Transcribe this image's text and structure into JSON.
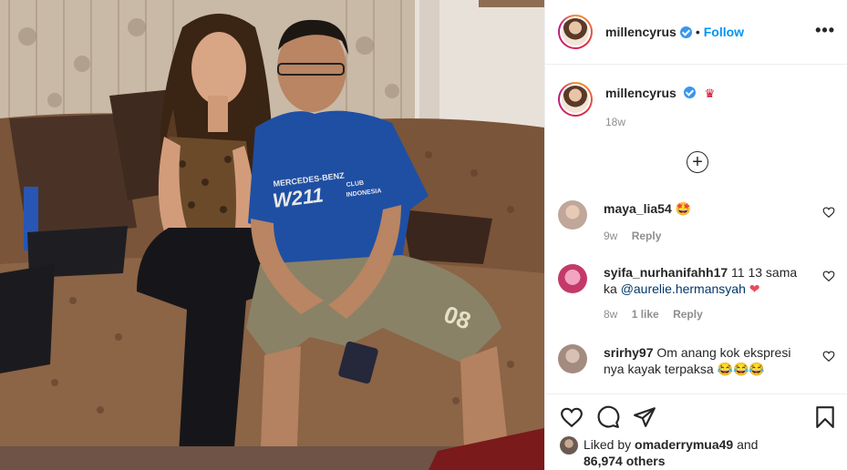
{
  "post": {
    "author": "millencyrus",
    "follow_label": "Follow",
    "dot": "•",
    "more_icon": "more-horizontal-icon",
    "more_glyph": "•••"
  },
  "caption": {
    "username": "millencyrus",
    "emoji": "♛",
    "time": "18w"
  },
  "load_more_glyph": "+",
  "comments": [
    {
      "username": "maya_lia54",
      "text": "🤩",
      "time": "9w",
      "likes": "",
      "reply": "Reply"
    },
    {
      "username": "syifa_nurhanifahh17",
      "text": "11 13 sama ka",
      "mention": "@aurelie.hermansyah",
      "emoji": "❤",
      "time": "8w",
      "likes": "1 like",
      "reply": "Reply"
    },
    {
      "username": "srirhy97",
      "text": "Om anang kok ekspresi nya kayak terpaksa",
      "emoji": "😂😂😂",
      "time": "",
      "likes": "",
      "reply": ""
    }
  ],
  "likes": {
    "prefix": "Liked by",
    "user": "omaderrymua49",
    "connector": "and",
    "others": "86,974 others"
  },
  "photo": {
    "shirt_text_1": "MERCEDES-BENZ",
    "shirt_text_2": "W211",
    "shirt_text_3": "CLUB",
    "shirt_text_4": "INDONESIA",
    "shorts_number": "08"
  },
  "colors": {
    "accent": "#0095f6",
    "verified": "#3897f0",
    "muted": "#8e8e8e",
    "heart_red": "#ed4956"
  }
}
